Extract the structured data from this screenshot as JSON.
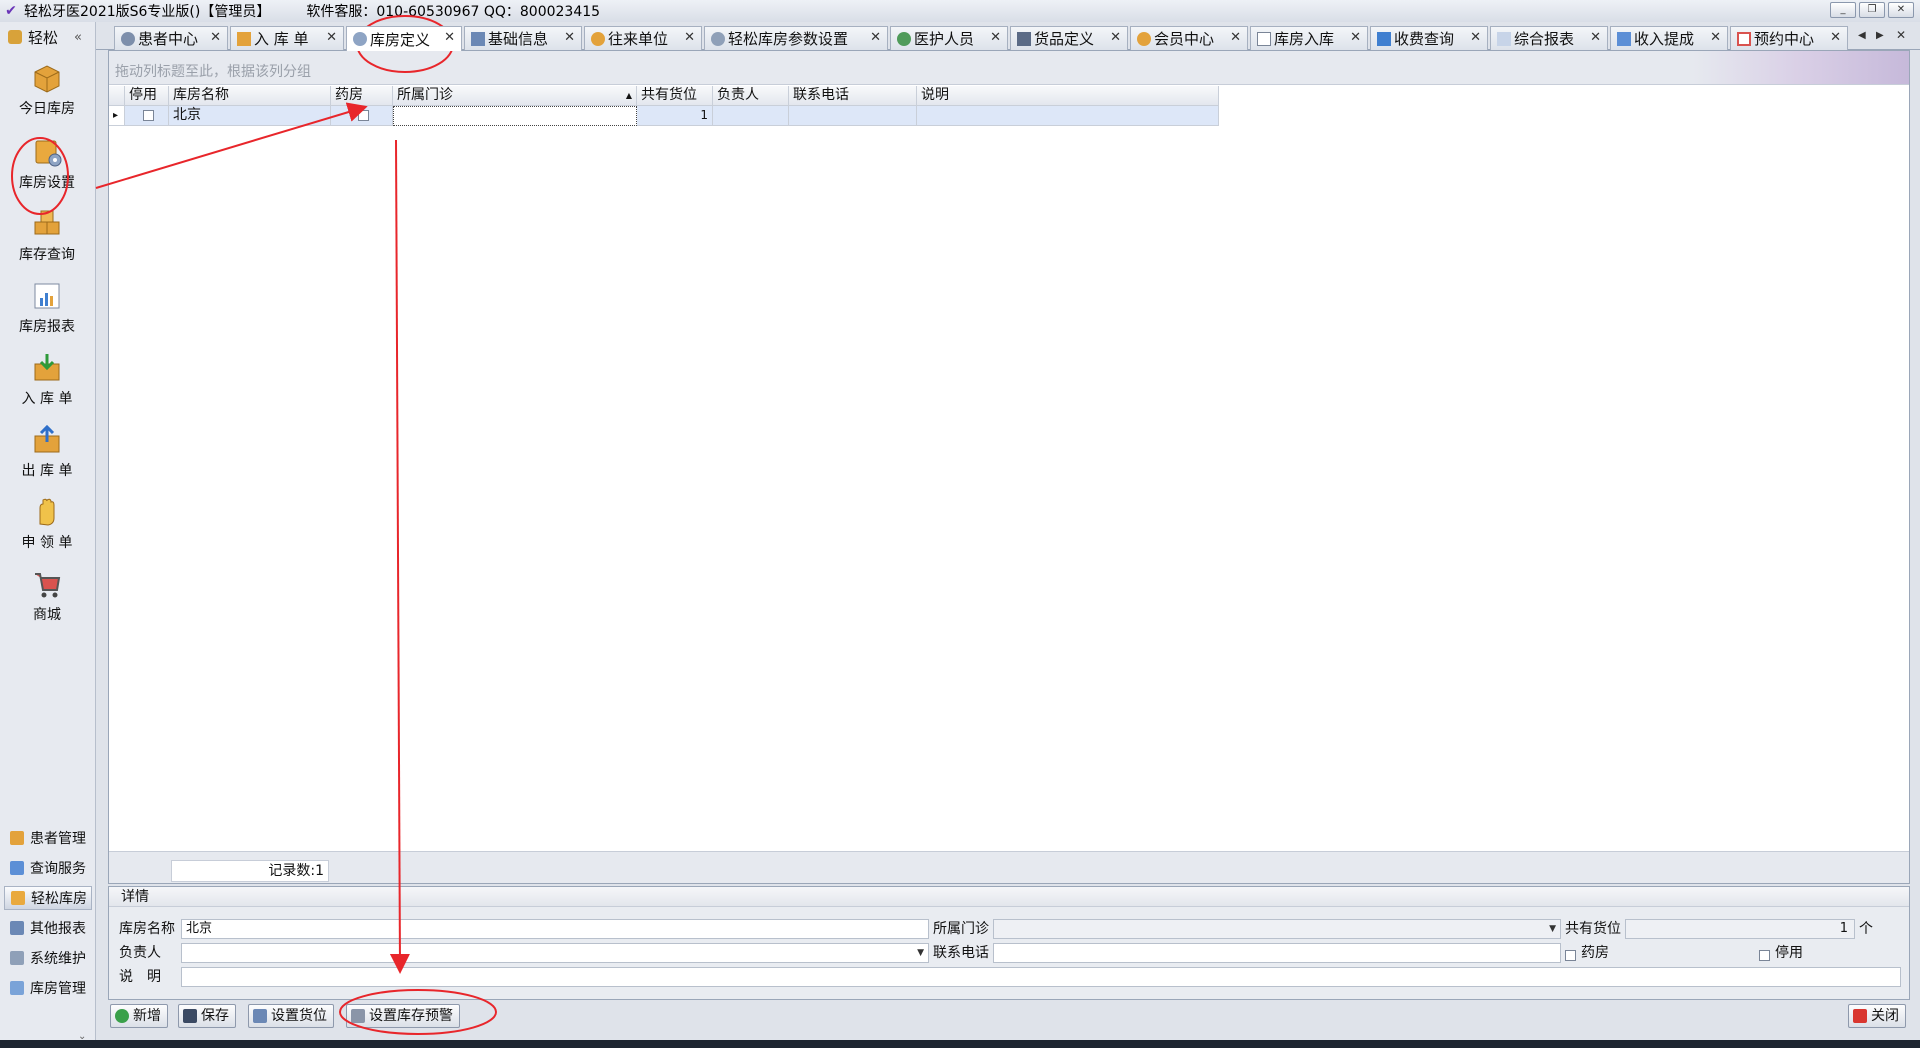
{
  "titlebar": {
    "title": "轻松牙医2021版S6专业版()【管理员】",
    "support": "软件客服：010-60530967 QQ：800023415",
    "minimize": "_",
    "restore": "❐",
    "close": "✕"
  },
  "nav": {
    "header": "轻松",
    "collapse": "«",
    "big_items": [
      "今日库房",
      "库房设置",
      "库存查询",
      "库房报表",
      "入 库 单",
      "出 库 单",
      "申 领 单",
      "商城"
    ],
    "small_items": [
      "患者管理",
      "查询服务",
      "轻松库房",
      "其他报表",
      "系统维护",
      "库房管理"
    ],
    "more": "⌄"
  },
  "tabs": [
    {
      "label": "患者中心"
    },
    {
      "label": "入 库 单"
    },
    {
      "label": "库房定义"
    },
    {
      "label": "基础信息"
    },
    {
      "label": "往来单位"
    },
    {
      "label": "轻松库房参数设置"
    },
    {
      "label": "医护人员"
    },
    {
      "label": "货品定义"
    },
    {
      "label": "会员中心"
    },
    {
      "label": "库房入库"
    },
    {
      "label": "收费查询"
    },
    {
      "label": "综合报表"
    },
    {
      "label": "收入提成"
    },
    {
      "label": "预约中心"
    }
  ],
  "tab_close": "✕",
  "tab_scroll": {
    "left": "◀",
    "right": "▶",
    "close": "✕"
  },
  "grid": {
    "group_hint": "拖动列标题至此，根据该列分组",
    "columns": [
      "",
      "停用",
      "库房名称",
      "药房",
      "所属门诊",
      "共有货位",
      "负责人",
      "联系电话",
      "说明"
    ],
    "sort_indicator": "▲",
    "row_indicator": "▸",
    "rows": [
      {
        "disabled": false,
        "name": "北京",
        "pharmacy": false,
        "clinic": "",
        "slots": "1",
        "manager": "",
        "phone": "",
        "note": ""
      }
    ]
  },
  "status": {
    "record_count": "记录数:1"
  },
  "detail": {
    "header": "详情",
    "name_label": "库房名称",
    "name_value": "北京",
    "clinic_label": "所属门诊",
    "clinic_value": "",
    "slots_label": "共有货位",
    "slots_value": "1",
    "slots_unit": "个",
    "manager_label": "负责人",
    "manager_value": "",
    "phone_label": "联系电话",
    "phone_value": "",
    "pharmacy_label": "药房",
    "disabled_label": "停用",
    "note_label": "说　明",
    "note_value": ""
  },
  "buttons": {
    "add": "新增",
    "save": "保存",
    "set_slots": "设置货位",
    "set_warning": "设置库存预警",
    "close": "关闭"
  },
  "colors": {
    "annotation": "#e8262b",
    "selected_row": "#dde7f8",
    "accent_purple": "#6a35b8"
  }
}
